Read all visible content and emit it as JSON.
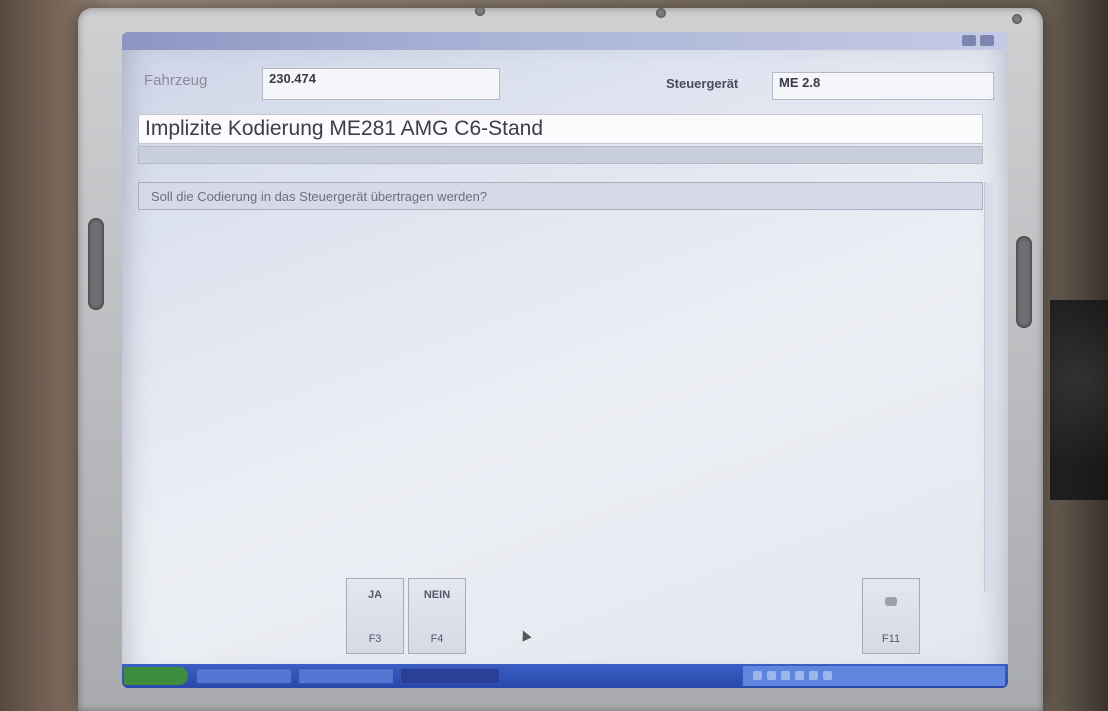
{
  "window": {
    "title": "",
    "titlebar_right": ""
  },
  "header": {
    "vehicle_label": "Fahrzeug",
    "vehicle_value": "230.474",
    "ecu_label": "Steuergerät",
    "ecu_value": "ME 2.8"
  },
  "main": {
    "heading": "Implizite Kodierung ME281 AMG C6-Stand",
    "question": "Soll die Codierung in das Steuergerät übertragen werden?"
  },
  "function_keys": [
    {
      "label": "JA",
      "key": "F3"
    },
    {
      "label": "NEIN",
      "key": "F4"
    },
    {
      "label": "",
      "key": "F11",
      "icon": "printer-icon"
    }
  ],
  "taskbar": {
    "start_label": "",
    "items": [
      "",
      "",
      ""
    ]
  },
  "colors": {
    "screen_bg": "#e6e9f1",
    "taskbar": "#2848aa",
    "start": "#3d8d3d"
  }
}
